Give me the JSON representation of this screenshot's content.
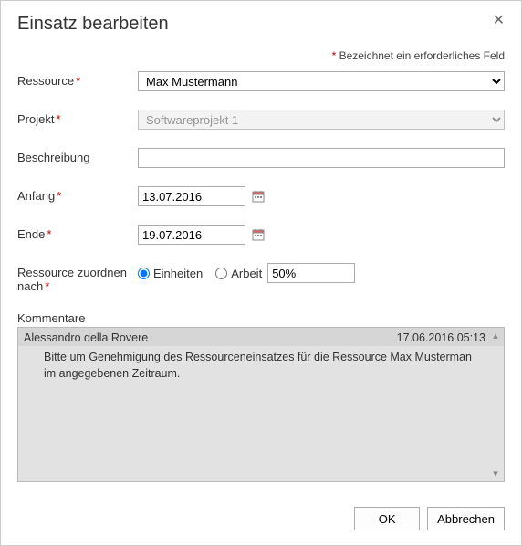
{
  "dialog": {
    "title": "Einsatz bearbeiten",
    "required_note_prefix": "*",
    "required_note_text": " Bezeichnet ein erforderliches Feld"
  },
  "labels": {
    "resource": "Ressource",
    "project": "Projekt",
    "description": "Beschreibung",
    "start": "Anfang",
    "end": "Ende",
    "assign_by": "Ressource zuordnen nach",
    "comments": "Kommentare"
  },
  "fields": {
    "resource_value": "Max Mustermann",
    "project_value": "Softwareprojekt 1",
    "description_value": "",
    "start_value": "13.07.2016",
    "end_value": "19.07.2016",
    "assign_units_label": "Einheiten",
    "assign_work_label": "Arbeit",
    "assign_selected": "units",
    "assign_amount": "50%"
  },
  "comment": {
    "author": "Alessandro della Rovere",
    "timestamp": "17.06.2016 05:13",
    "body": "Bitte um Genehmigung des Ressourceneinsatzes für die Ressource Max Musterman im angegebenen Zeitraum."
  },
  "buttons": {
    "ok": "OK",
    "cancel": "Abbrechen"
  }
}
